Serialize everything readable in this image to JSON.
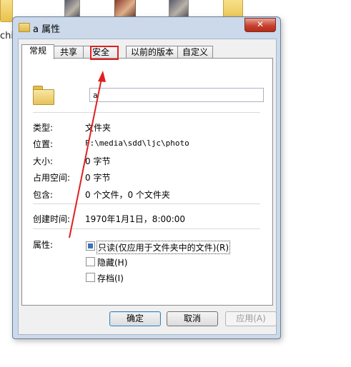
{
  "background": {
    "partial_label": "chi"
  },
  "dialog": {
    "title": "a 属性",
    "close_glyph": "✕",
    "tabs": [
      {
        "label": "常规"
      },
      {
        "label": "共享"
      },
      {
        "label": "安全"
      },
      {
        "label": "以前的版本"
      },
      {
        "label": "自定义"
      }
    ],
    "highlighted_tab": "安全",
    "name_value": "a",
    "properties": [
      {
        "label": "类型:",
        "value": "文件夹"
      },
      {
        "label": "位置:",
        "value": "F:\\media\\sdd\\ljc\\photo"
      },
      {
        "label": "大小:",
        "value": "0 字节"
      },
      {
        "label": "占用空间:",
        "value": "0 字节"
      },
      {
        "label": "包含:",
        "value": "0 个文件，0 个文件夹"
      }
    ],
    "created": {
      "label": "创建时间:",
      "value": "1970年1月1日，8:00:00"
    },
    "attributes_label": "属性:",
    "attributes": [
      {
        "label": "只读(仅应用于文件夹中的文件)(R)",
        "state": "partial"
      },
      {
        "label": "隐藏(H)",
        "state": "unchecked"
      },
      {
        "label": "存档(I)",
        "state": "unchecked"
      }
    ],
    "buttons": {
      "ok": "确定",
      "cancel": "取消",
      "apply": "应用(A)"
    }
  },
  "colors": {
    "highlight": "#e02020",
    "arrow": "#e02020",
    "close_button": "#c7432f"
  },
  "icons": [
    "folder-icon",
    "close-icon",
    "red-arrow"
  ]
}
